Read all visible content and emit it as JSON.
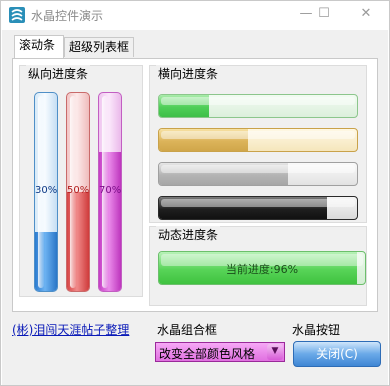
{
  "window": {
    "title": "水晶控件演示",
    "controls": {
      "minimize": "—",
      "maximize": "☐",
      "close": "✕"
    }
  },
  "tabs": [
    {
      "label": "滚动条",
      "active": true
    },
    {
      "label": "超级列表框",
      "active": false
    }
  ],
  "vertical_group": {
    "title": "纵向进度条",
    "bars": [
      {
        "label": "30%",
        "value": 0.3,
        "color": "blue"
      },
      {
        "label": "50%",
        "value": 0.5,
        "color": "red"
      },
      {
        "label": "70%",
        "value": 0.7,
        "color": "pink"
      }
    ]
  },
  "horizontal_group": {
    "title": "横向进度条",
    "bars": [
      {
        "value": 0.25,
        "color": "green"
      },
      {
        "value": 0.45,
        "color": "gold"
      },
      {
        "value": 0.65,
        "color": "silver"
      },
      {
        "value": 0.85,
        "color": "black"
      }
    ]
  },
  "dynamic_group": {
    "title": "动态进度条",
    "label": "当前进度:96%",
    "value": 0.96
  },
  "footer": {
    "link_text": "(彬)泪闯天涯帖子整理",
    "combo_label": "水晶组合框",
    "combo_value": "改变全部颜色风格",
    "button_group_label": "水晶按钮",
    "close_button": "关闭(C)"
  }
}
